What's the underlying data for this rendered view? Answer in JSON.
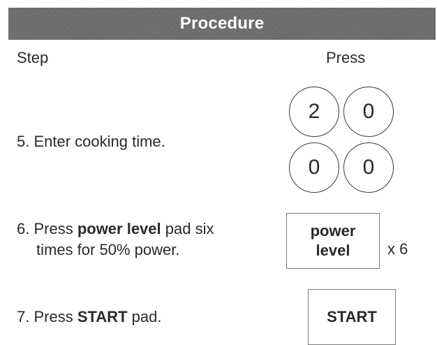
{
  "header": {
    "title": "Procedure"
  },
  "columns": {
    "step": "Step",
    "press": "Press"
  },
  "steps": {
    "step5": {
      "text": "5. Enter cooking time."
    },
    "step6": {
      "prefix": "6. Press ",
      "bold": "power level",
      "suffix": " pad six",
      "line2": "times for 50% power."
    },
    "step7": {
      "prefix": "7. Press ",
      "bold": "START",
      "suffix": " pad."
    }
  },
  "keys": {
    "digits": [
      "2",
      "0",
      "0",
      "0"
    ],
    "power_level_line1": "power",
    "power_level_line2": "level",
    "power_level_times": "x 6",
    "start": "START"
  }
}
